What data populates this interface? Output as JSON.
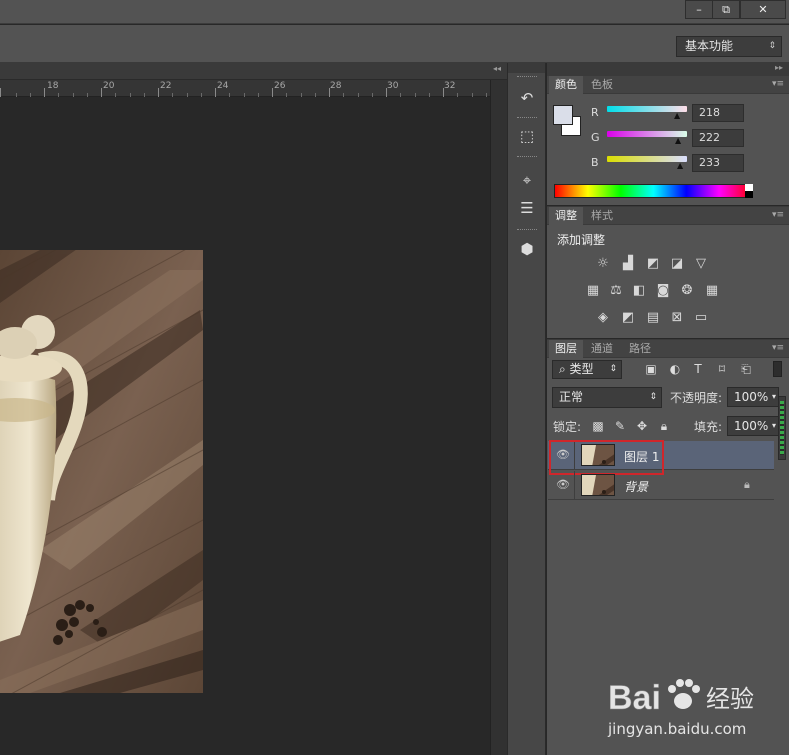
{
  "window_controls": {
    "minimize": "–",
    "restore": "⧉",
    "close": "✕"
  },
  "workspace_select": "基本功能",
  "ruler": {
    "ticks": [
      "18",
      "20",
      "22",
      "24",
      "26",
      "28",
      "30",
      "32"
    ]
  },
  "color_panel": {
    "tabs": [
      "颜色",
      "色板"
    ],
    "channels": [
      {
        "label": "R",
        "value": "218"
      },
      {
        "label": "G",
        "value": "222"
      },
      {
        "label": "B",
        "value": "233"
      }
    ],
    "foreground_color": "#dadee9"
  },
  "adjustments_panel": {
    "tabs": [
      "调整",
      "样式"
    ],
    "title": "添加调整"
  },
  "layers_panel": {
    "tabs": [
      "图层",
      "通道",
      "路径"
    ],
    "filter_kind": "类型",
    "blend_mode": "正常",
    "opacity_label": "不透明度:",
    "opacity_value": "100%",
    "lock_label": "锁定:",
    "fill_label": "填充:",
    "fill_value": "100%",
    "layers": [
      {
        "name": "图层 1",
        "selected": true
      },
      {
        "name": "背景",
        "locked": true
      }
    ]
  },
  "watermark": {
    "brand": "Bai",
    "brand2": "经验",
    "url": "jingyan.baidu.com"
  },
  "colors": {
    "highlight_box": "#d0262b",
    "selected_layer": "#5a6478"
  }
}
